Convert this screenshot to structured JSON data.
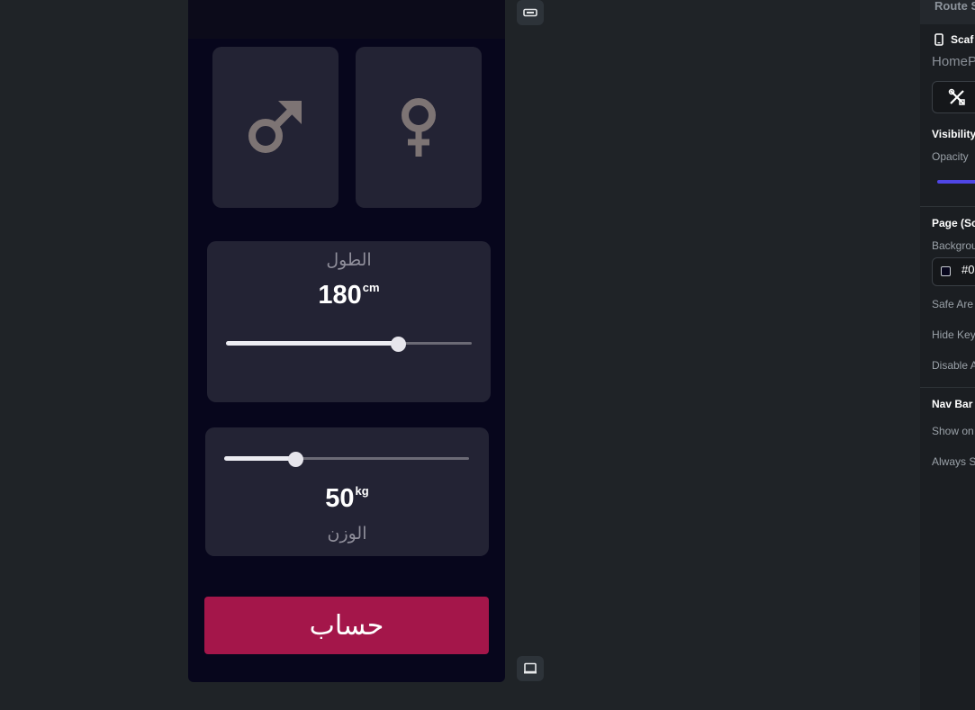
{
  "app": {
    "gender": {
      "male_icon": "male-symbol-icon",
      "female_icon": "female-symbol-icon",
      "icon_color": "#7d7474"
    },
    "height": {
      "label": "الطول",
      "value": "180",
      "unit": "cm",
      "slider_fraction": 0.7
    },
    "weight": {
      "value": "50",
      "unit": "kg",
      "label": "الوزن",
      "slider_fraction": 0.29
    },
    "calculate_label": "حساب",
    "accent_color": "#a4164a",
    "background_color": "#07061c",
    "card_color": "#232334"
  },
  "side_buttons": {
    "top_icon": "resize-device-icon",
    "bottom_icon": "laptop-icon"
  },
  "panel": {
    "header_title": "Route S",
    "scaffold_label": "Scaf",
    "scaffold_icon": "phone-icon",
    "page_name": "HomeP",
    "tool_icon": "tools-icon",
    "visibility_label": "Visibility",
    "opacity_label": "Opacity",
    "page_section_label": "Page (Sc",
    "background_label": "Backgrou",
    "background_value": "#0",
    "safe_area_label": "Safe Are",
    "hide_keyboard_label": "Hide Key",
    "disable_label": "Disable A",
    "navbar_label": "Nav Bar",
    "show_on_label": "Show on",
    "always_label": "Always S",
    "opacity_color": "#4f46e5"
  }
}
